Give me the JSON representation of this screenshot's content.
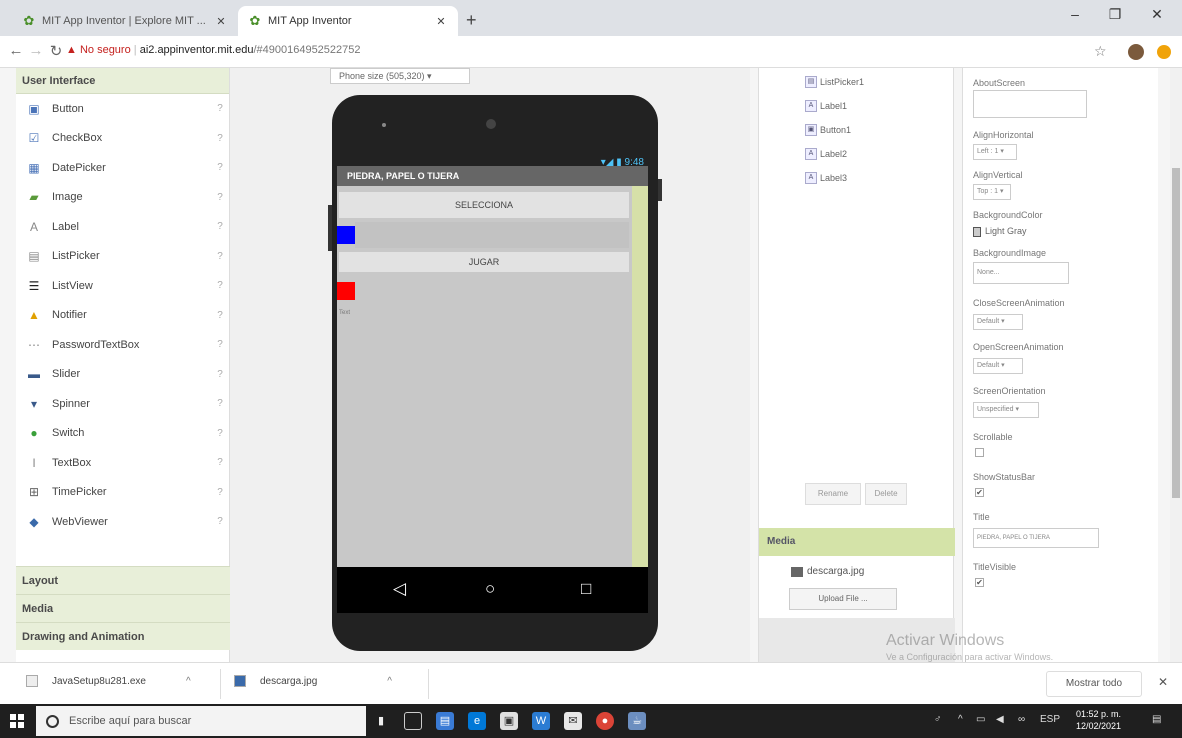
{
  "browser": {
    "tabs": [
      {
        "title": "MIT App Inventor | Explore MIT ..."
      },
      {
        "title": "MIT App Inventor"
      }
    ],
    "new_tab": "+",
    "url_warning": "No seguro",
    "url_host": "ai2.appinventor.mit.edu",
    "url_path": "/#4900164952522752"
  },
  "palette": {
    "header": "User Interface",
    "items": [
      {
        "label": "Button",
        "icon": "button-icon"
      },
      {
        "label": "CheckBox",
        "icon": "checkbox-icon"
      },
      {
        "label": "DatePicker",
        "icon": "datepicker-icon"
      },
      {
        "label": "Image",
        "icon": "image-icon"
      },
      {
        "label": "Label",
        "icon": "label-icon"
      },
      {
        "label": "ListPicker",
        "icon": "listpicker-icon"
      },
      {
        "label": "ListView",
        "icon": "listview-icon"
      },
      {
        "label": "Notifier",
        "icon": "notifier-icon"
      },
      {
        "label": "PasswordTextBox",
        "icon": "password-icon"
      },
      {
        "label": "Slider",
        "icon": "slider-icon"
      },
      {
        "label": "Spinner",
        "icon": "spinner-icon"
      },
      {
        "label": "Switch",
        "icon": "switch-icon"
      },
      {
        "label": "TextBox",
        "icon": "textbox-icon"
      },
      {
        "label": "TimePicker",
        "icon": "timepicker-icon"
      },
      {
        "label": "WebViewer",
        "icon": "webviewer-icon"
      }
    ],
    "help": "?",
    "categories": [
      "Layout",
      "Media",
      "Drawing and Animation"
    ]
  },
  "viewer": {
    "phone_size": "Phone size (505,320) ▾",
    "status_time": "▾◢ ▮ 9:48",
    "app_title": "PIEDRA, PAPEL O TIJERA",
    "button_select": "SELECCIONA",
    "button_play": "JUGAR",
    "tiny_text": "Text",
    "nav_back": "◁",
    "nav_home": "○",
    "nav_recent": "□",
    "colors": {
      "blue": "#0000ff",
      "red": "#ff0000",
      "scroll_strip": "#d6e0a8"
    }
  },
  "components": {
    "items": [
      "ListPicker1",
      "Label1",
      "Button1",
      "Label2",
      "Label3"
    ],
    "rename": "Rename",
    "delete": "Delete",
    "media_header": "Media",
    "media_file": "descarga.jpg",
    "upload": "Upload File ..."
  },
  "properties": {
    "about_screen": "AboutScreen",
    "align_h": "AlignHorizontal",
    "align_h_val": "Left : 1 ▾",
    "align_v": "AlignVertical",
    "align_v_val": "Top : 1 ▾",
    "bg_color": "BackgroundColor",
    "bg_color_val": "Light Gray",
    "bg_image": "BackgroundImage",
    "bg_image_val": "None...",
    "close_anim": "CloseScreenAnimation",
    "close_anim_val": "Default ▾",
    "open_anim": "OpenScreenAnimation",
    "open_anim_val": "Default ▾",
    "orientation": "ScreenOrientation",
    "orientation_val": "Unspecified ▾",
    "scrollable": "Scrollable",
    "show_status": "ShowStatusBar",
    "title": "Title",
    "title_val": "PIEDRA, PAPEL O TIJERA",
    "title_visible": "TitleVisible",
    "check": "✔"
  },
  "watermark": {
    "line1": "Activar Windows",
    "line2": "Ve a Configuración para activar Windows."
  },
  "downloads": {
    "items": [
      "JavaSetup8u281.exe",
      "descarga.jpg"
    ],
    "caret": "^",
    "show_all": "Mostrar todo",
    "close": "✕"
  },
  "taskbar": {
    "search_placeholder": "Escribe aquí para buscar",
    "lang": "ESP",
    "time": "01:52 p. m.",
    "date": "12/02/2021"
  }
}
